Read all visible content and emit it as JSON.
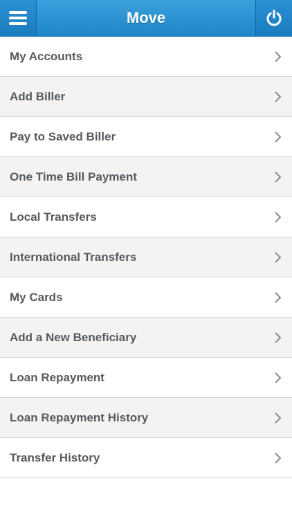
{
  "header": {
    "title": "Move",
    "menu_icon": "hamburger-menu-icon",
    "power_icon": "power-icon"
  },
  "colors": {
    "header_bg": "#2990d3",
    "item_text": "#555a5f",
    "alt_row": "#f3f3f3",
    "chevron": "#8a8a8a"
  },
  "menu": {
    "items": [
      {
        "label": "My Accounts"
      },
      {
        "label": "Add Biller"
      },
      {
        "label": "Pay to Saved Biller"
      },
      {
        "label": "One Time Bill Payment"
      },
      {
        "label": "Local Transfers"
      },
      {
        "label": "International Transfers"
      },
      {
        "label": "My Cards"
      },
      {
        "label": "Add a New Beneficiary"
      },
      {
        "label": "Loan Repayment"
      },
      {
        "label": "Loan Repayment History"
      },
      {
        "label": "Transfer History"
      }
    ]
  }
}
